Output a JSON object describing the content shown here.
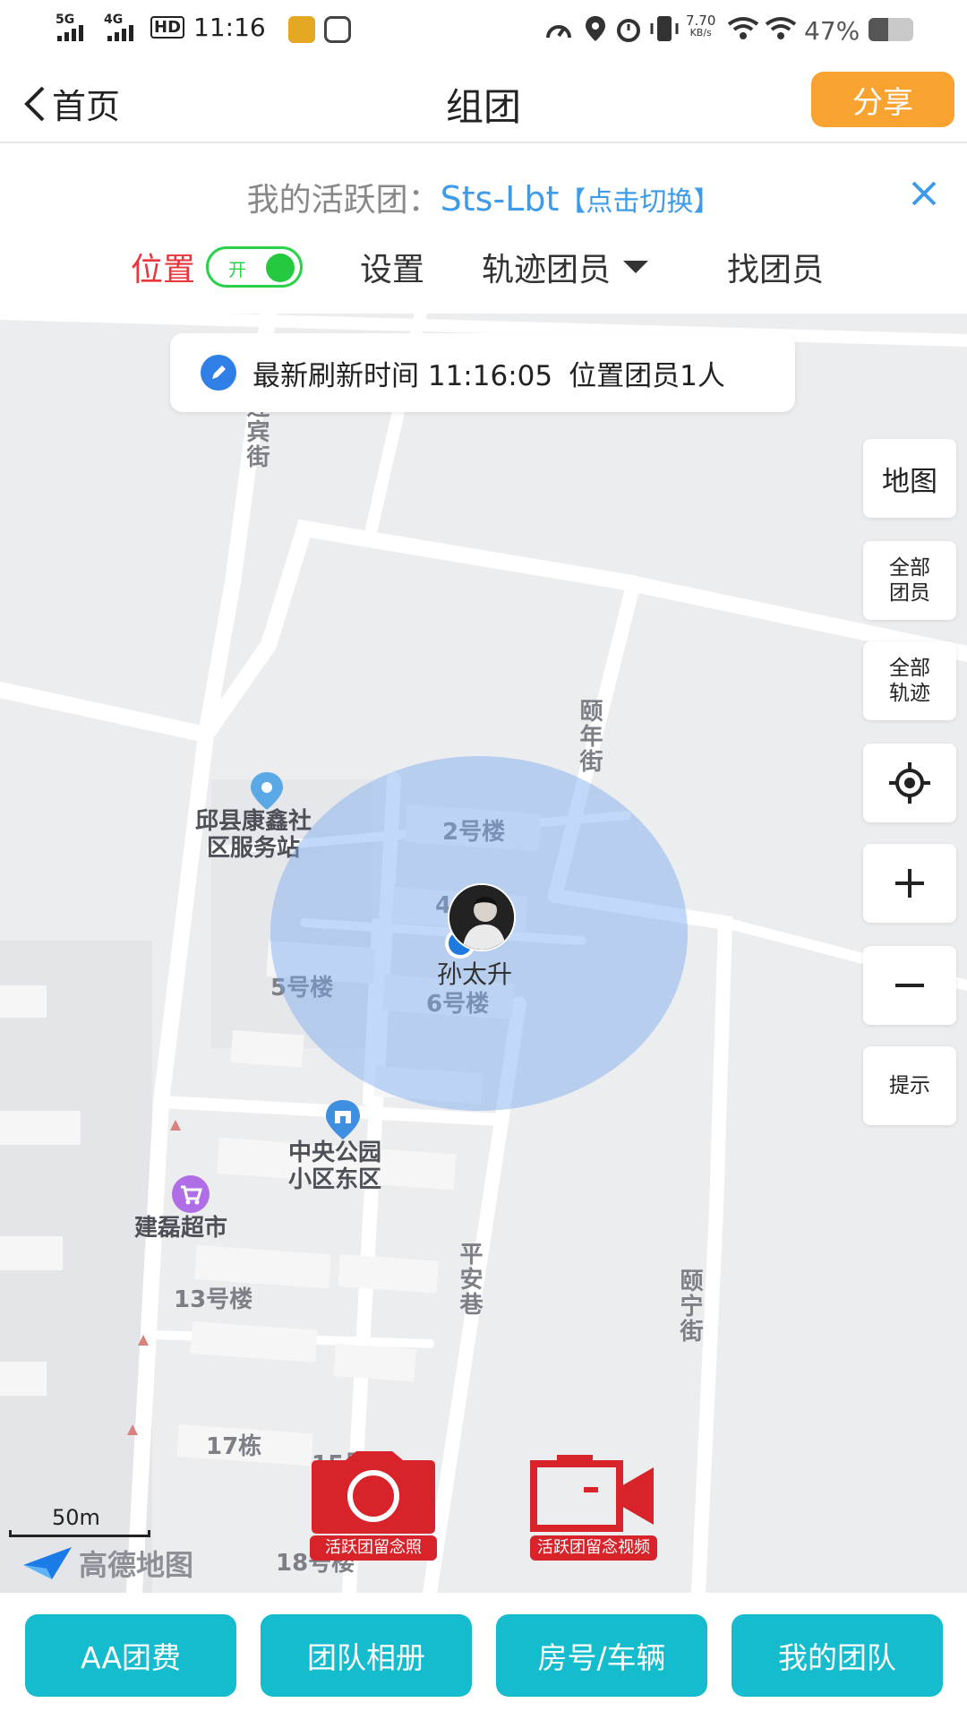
{
  "status_bar": {
    "time": "11:16",
    "net1": "5G",
    "net2": "4G",
    "hd": "HD",
    "speed_value": "7.70",
    "speed_unit": "KB/s",
    "battery": "47%"
  },
  "header": {
    "back_label": "首页",
    "title": "组团",
    "share_label": "分享"
  },
  "group": {
    "active_label": "我的活跃团：",
    "active_name": "Sts-Lbt",
    "switch_label": "【点击切换】"
  },
  "tabs": {
    "location_label": "位置",
    "toggle_text": "开",
    "toggle_on": true,
    "settings_label": "设置",
    "track_members_label": "轨迹团员",
    "find_members_label": "找团员"
  },
  "map": {
    "refresh_text": "最新刷新时间 11:16:05",
    "members_text": "位置团员1人",
    "side_buttons": {
      "map": "地图",
      "all_members": [
        "全部",
        "团员"
      ],
      "all_tracks": [
        "全部",
        "轨迹"
      ],
      "tips": "提示"
    },
    "labels": {
      "street_yingbin": "迎宾街",
      "street_yinian": "颐年街",
      "street_pingan": "平安巷",
      "street_yining": "颐宁街",
      "bldg_2": "2号楼",
      "bldg_4": "4",
      "bldg_5": "5号楼",
      "bldg_6": "6号楼",
      "bldg_13": "13号楼",
      "bldg_17": "17栋",
      "bldg_15": "15号楼",
      "bldg_18": "18号楼",
      "poi_service_1": "邱县康鑫社",
      "poi_service_2": "区服务站",
      "poi_park_1": "中央公园",
      "poi_park_2": "小区东区",
      "poi_market": "建磊超市"
    },
    "member_name": "孙太升",
    "scale_text": "50m",
    "provider": "高德地图",
    "photo_label": "活跃团留念照",
    "video_label": "活跃团留念视频"
  },
  "bottom_bar": {
    "buttons": [
      "AA团费",
      "团队相册",
      "房号/车辆",
      "我的团队"
    ]
  },
  "colors": {
    "share": "#f8a230",
    "link_blue": "#3d9be9",
    "location_red": "#e8363d",
    "toggle_green": "#2bd14a",
    "bottom_teal": "#14bccd",
    "camera_red": "#d8232a"
  }
}
